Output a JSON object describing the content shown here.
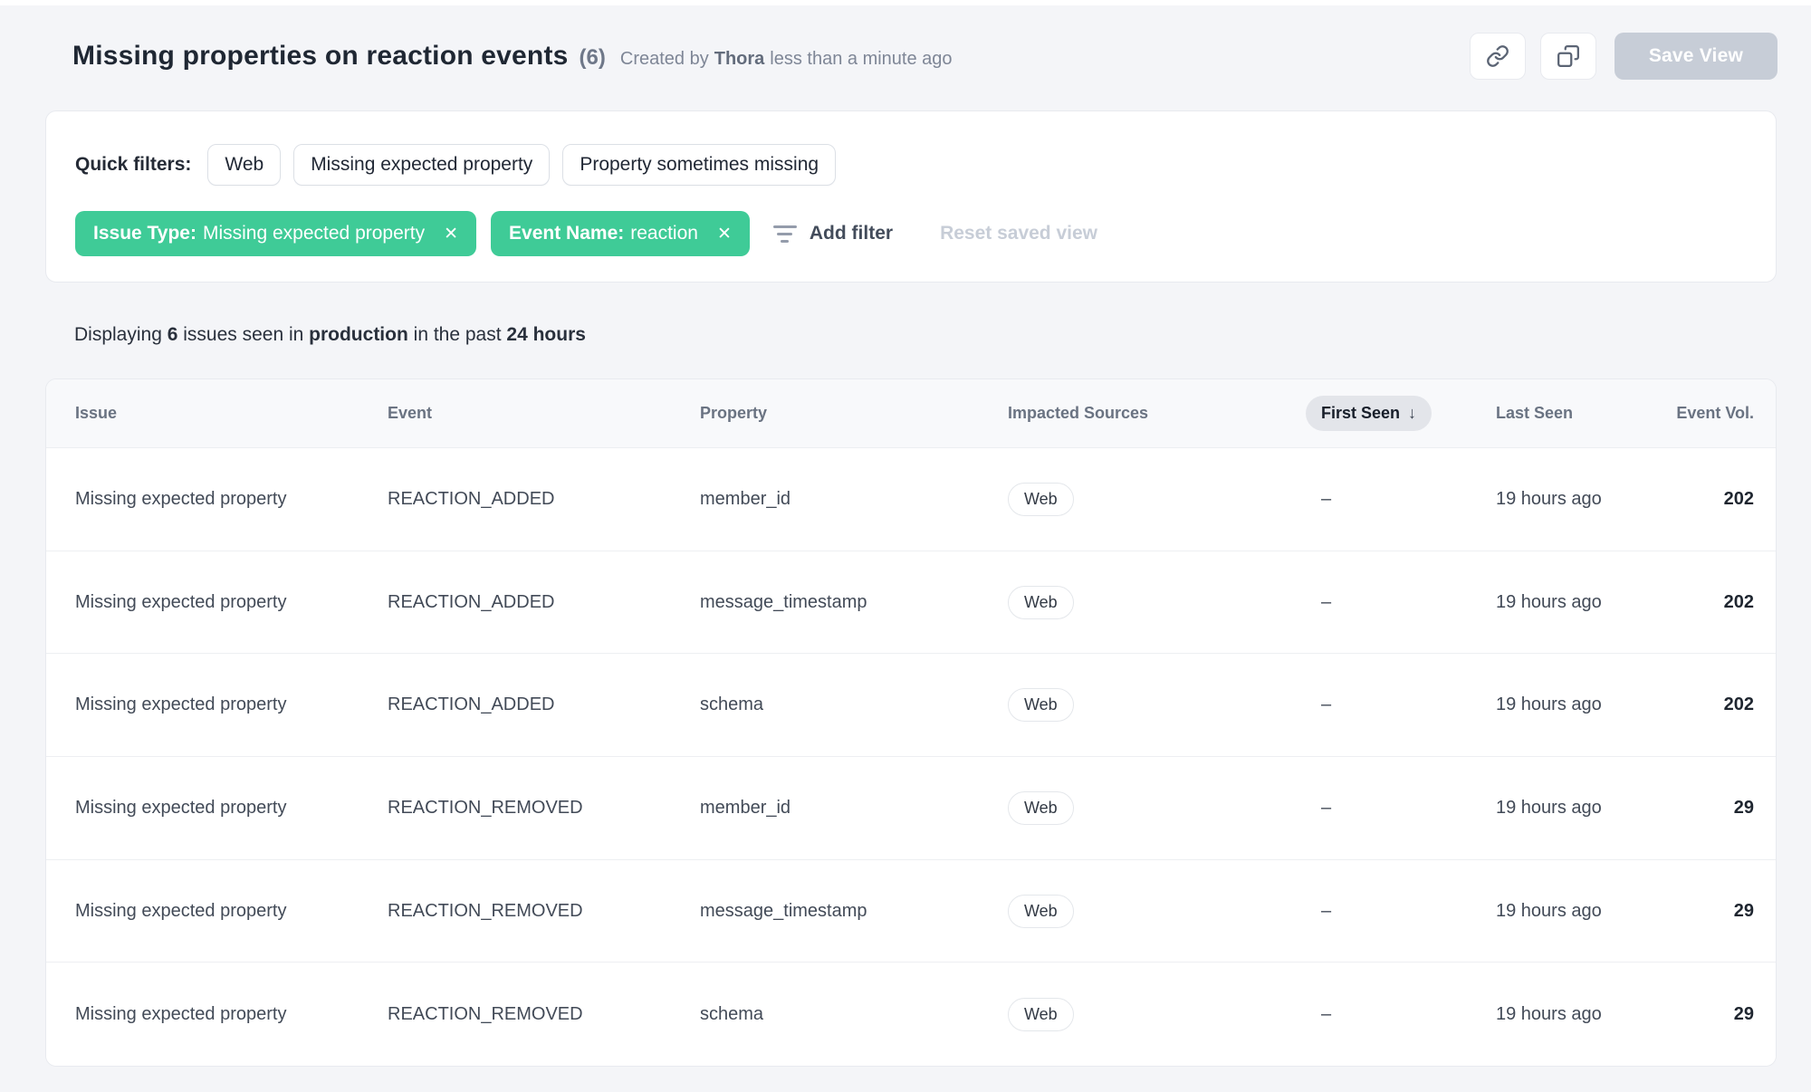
{
  "header": {
    "title": "Missing properties on reaction events",
    "count": "(6)",
    "created_by_prefix": "Created by",
    "created_by_name": "Thora",
    "created_by_time": "less than a minute ago",
    "save_view_label": "Save View"
  },
  "filters": {
    "quick_filters_label": "Quick filters:",
    "quick_filters": [
      "Web",
      "Missing expected property",
      "Property sometimes missing"
    ],
    "active_filters": [
      {
        "label": "Issue Type:",
        "value": "Missing expected property",
        "remove_icon": "✕"
      },
      {
        "label": "Event Name:",
        "value": "reaction",
        "remove_icon": "✕"
      }
    ],
    "add_filter_label": "Add filter",
    "reset_label": "Reset saved view"
  },
  "status": {
    "segments": [
      {
        "text": "Displaying ",
        "bold": false
      },
      {
        "text": "6",
        "bold": true
      },
      {
        "text": " issues seen in ",
        "bold": false
      },
      {
        "text": "production",
        "bold": true
      },
      {
        "text": " in the past ",
        "bold": false
      },
      {
        "text": "24 hours",
        "bold": true
      }
    ]
  },
  "table": {
    "columns": [
      "Issue",
      "Event",
      "Property",
      "Impacted Sources",
      "First Seen",
      "Last Seen",
      "Event Vol."
    ],
    "sort": {
      "column": "First Seen",
      "direction_icon": "↓"
    },
    "rows": [
      {
        "issue": "Missing expected property",
        "event": "REACTION_ADDED",
        "property": "member_id",
        "sources": [
          "Web"
        ],
        "first_seen": "–",
        "last_seen": "19 hours ago",
        "event_vol": "202"
      },
      {
        "issue": "Missing expected property",
        "event": "REACTION_ADDED",
        "property": "message_timestamp",
        "sources": [
          "Web"
        ],
        "first_seen": "–",
        "last_seen": "19 hours ago",
        "event_vol": "202"
      },
      {
        "issue": "Missing expected property",
        "event": "REACTION_ADDED",
        "property": "schema",
        "sources": [
          "Web"
        ],
        "first_seen": "–",
        "last_seen": "19 hours ago",
        "event_vol": "202"
      },
      {
        "issue": "Missing expected property",
        "event": "REACTION_REMOVED",
        "property": "member_id",
        "sources": [
          "Web"
        ],
        "first_seen": "–",
        "last_seen": "19 hours ago",
        "event_vol": "29"
      },
      {
        "issue": "Missing expected property",
        "event": "REACTION_REMOVED",
        "property": "message_timestamp",
        "sources": [
          "Web"
        ],
        "first_seen": "–",
        "last_seen": "19 hours ago",
        "event_vol": "29"
      },
      {
        "issue": "Missing expected property",
        "event": "REACTION_REMOVED",
        "property": "schema",
        "sources": [
          "Web"
        ],
        "first_seen": "–",
        "last_seen": "19 hours ago",
        "event_vol": "29"
      }
    ]
  },
  "colors": {
    "accent_green": "#3fcb97",
    "disabled_button": "#c7cdd7",
    "page_background": "#f4f5f8"
  }
}
